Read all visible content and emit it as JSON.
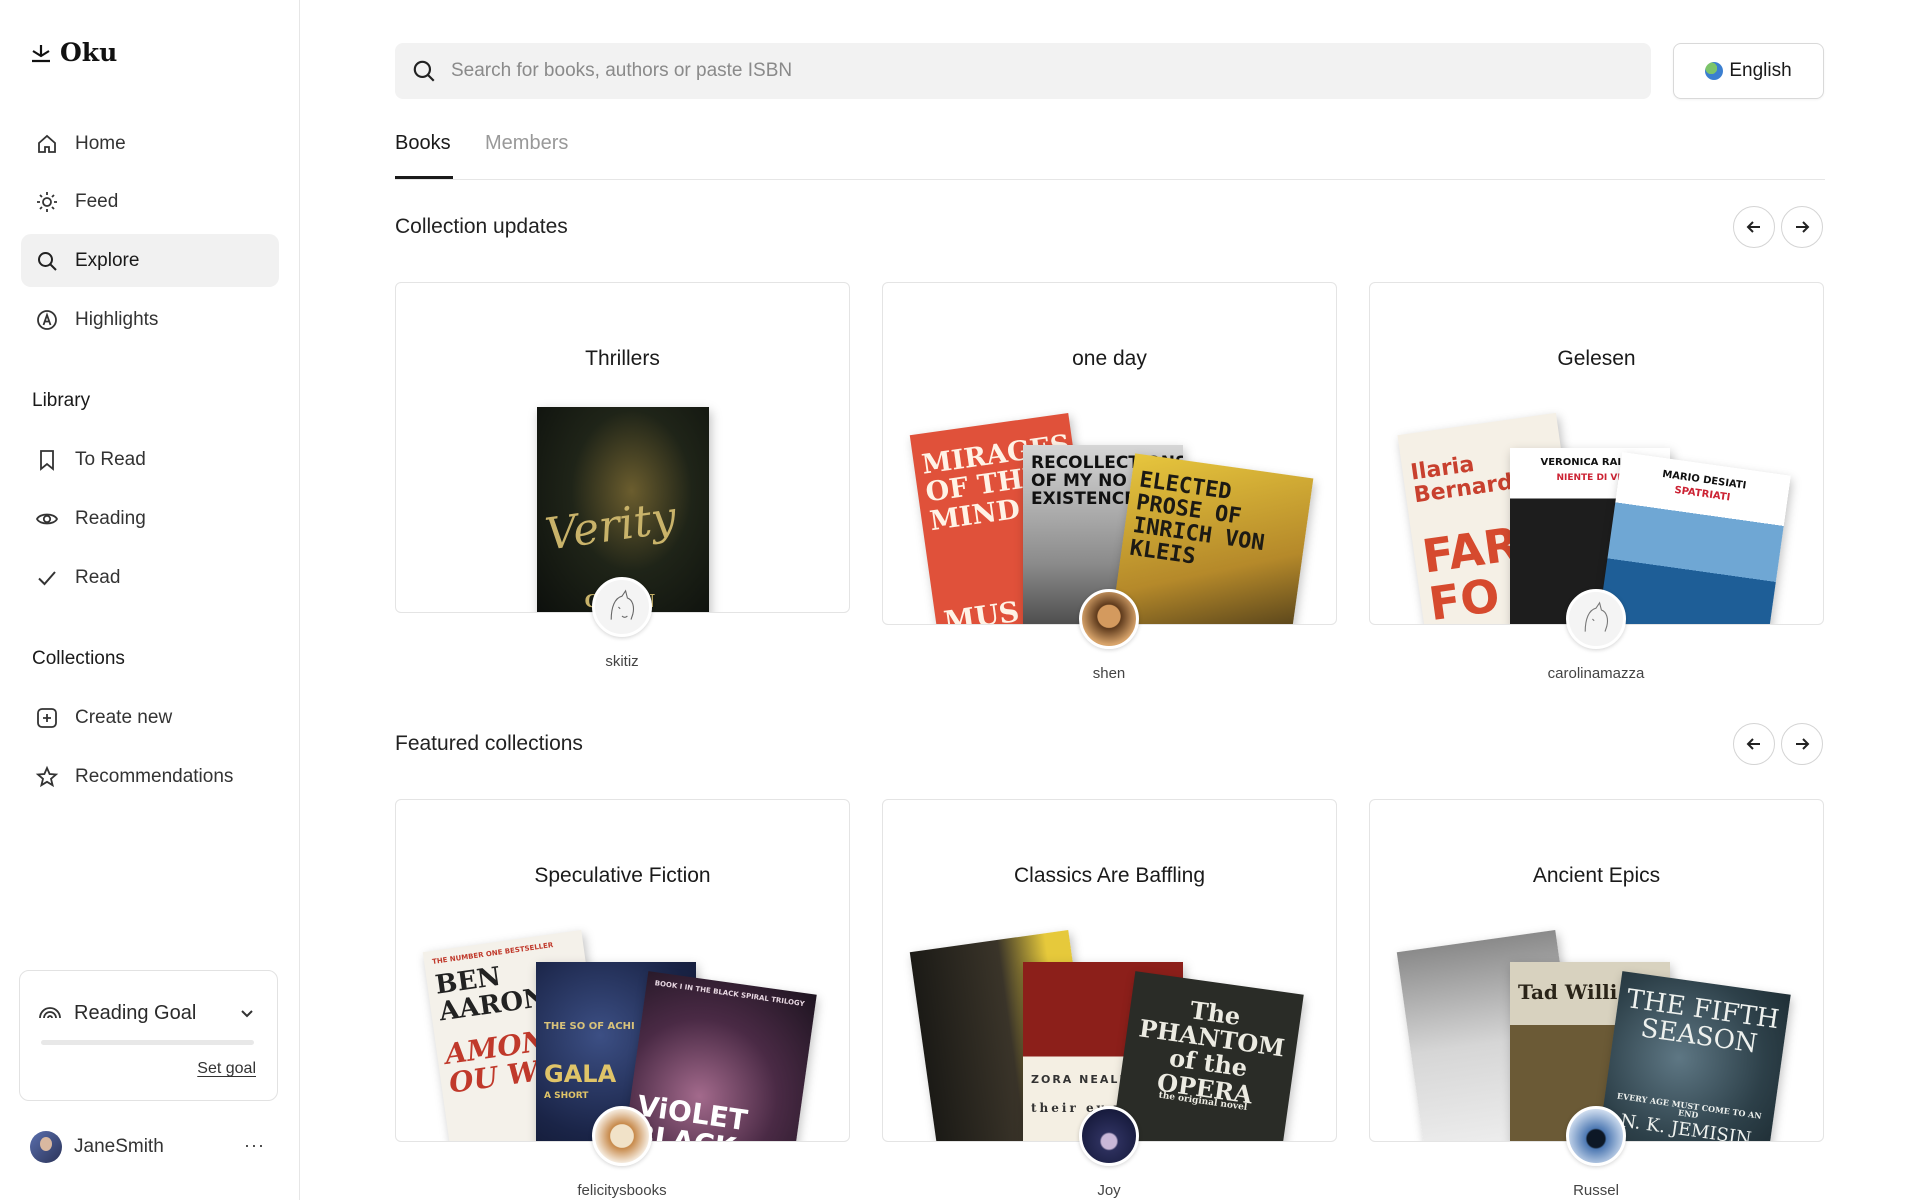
{
  "app": {
    "name": "Oku"
  },
  "sidebar": {
    "nav": [
      {
        "label": "Home",
        "icon": "home-icon"
      },
      {
        "label": "Feed",
        "icon": "sun-icon"
      },
      {
        "label": "Explore",
        "icon": "search-icon",
        "active": true
      },
      {
        "label": "Highlights",
        "icon": "highlight-icon"
      }
    ],
    "library_label": "Library",
    "library": [
      {
        "label": "To Read",
        "icon": "bookmark-icon"
      },
      {
        "label": "Reading",
        "icon": "eye-icon"
      },
      {
        "label": "Read",
        "icon": "check-icon"
      }
    ],
    "collections_label": "Collections",
    "collections": [
      {
        "label": "Create new",
        "icon": "plus-square-icon"
      },
      {
        "label": "Recommendations",
        "icon": "star-icon"
      }
    ],
    "goal": {
      "title": "Reading Goal",
      "link": "Set goal",
      "progress": 0
    },
    "user": {
      "name": "JaneSmith",
      "more": "···"
    }
  },
  "search": {
    "placeholder": "Search for books, authors or paste ISBN",
    "value": ""
  },
  "language": {
    "label": "English"
  },
  "tabs": [
    {
      "label": "Books",
      "active": true
    },
    {
      "label": "Members",
      "active": false
    }
  ],
  "sections": {
    "updates": {
      "title": "Collection updates",
      "cards": [
        {
          "title": "Thrillers",
          "user": "skitiz"
        },
        {
          "title": "one day",
          "user": "shen"
        },
        {
          "title": "Gelesen",
          "user": "carolinamazza"
        }
      ]
    },
    "featured": {
      "title": "Featured collections",
      "cards": [
        {
          "title": "Speculative Fiction",
          "user": "felicitysbooks"
        },
        {
          "title": "Classics Are Baffling",
          "user": "Joy"
        },
        {
          "title": "Ancient Epics",
          "user": "Russel"
        }
      ]
    }
  },
  "books": {
    "verity": {
      "title": "Verity",
      "author": "CO    N"
    },
    "mirages": {
      "title": "MIRAGES OF THE MIND",
      "extra": "MUS"
    },
    "recollections": {
      "title": "RECOLLECTIONS OF MY NO EXISTENCE"
    },
    "kleist": {
      "title": "ELECTED PROSE OF INRICH VON KLEIS"
    },
    "bernardi": {
      "author": "Ilaria Bernardi",
      "title": "FAR FO"
    },
    "raimo": {
      "author": "VERONICA RAIMO",
      "title": "NIENTE DI VE"
    },
    "desiati": {
      "author": "MARIO DESIATI",
      "title": "SPATRIATI"
    },
    "aaronovitch": {
      "author": "BEN AARONO",
      "title": "AMON OU WEA",
      "kicker": "THE NUMBER ONE BESTSELLER"
    },
    "galaxy": {
      "title": "GALA",
      "kicker": "THE SO OF ACHI",
      "sub": "A SHORT"
    },
    "violet": {
      "title": "ViOLET BLACK",
      "kicker": "BOOK I IN THE BLACK SPIRAL TRILOGY"
    },
    "zora": {
      "author": "ZORA NEALE",
      "title": "their ey wate"
    },
    "phantom": {
      "title": "The PHANTOM of the OPERA",
      "sub": "the original novel"
    },
    "tad": {
      "author": "Tad Willi"
    },
    "fifth": {
      "title": "THE FIFTH SEASON",
      "tagline": "EVERY AGE MUST COME TO AN END",
      "author": "N. K. JEMISIN"
    }
  },
  "colors": {
    "accent": "#1a1a1a",
    "active_bg": "#f1f1f1",
    "muted": "#999999"
  }
}
